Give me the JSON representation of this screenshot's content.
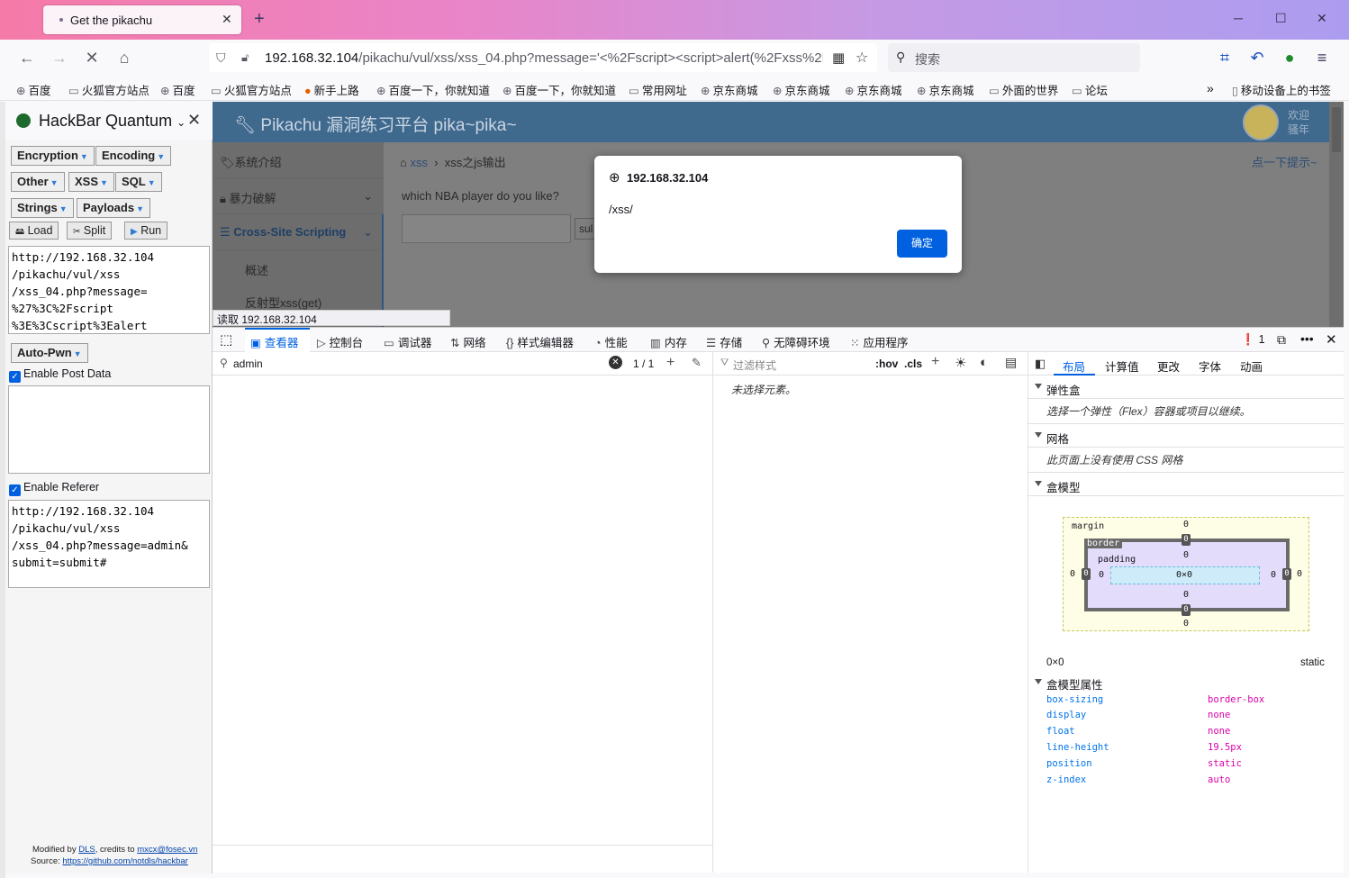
{
  "browser": {
    "tab_title": "Get the pikachu",
    "url_host": "192.168.32.104",
    "url_path": "/pikachu/vul/xss/xss_04.php?message='<%2Fscript><script>alert(%2Fxss%2F)",
    "search_placeholder": "搜索"
  },
  "bookmarks": [
    {
      "label": "百度"
    },
    {
      "label": "火狐官方站点"
    },
    {
      "label": "百度"
    },
    {
      "label": "火狐官方站点"
    },
    {
      "label": "新手上路"
    },
    {
      "label": "百度一下，你就知道"
    },
    {
      "label": "百度一下，你就知道"
    },
    {
      "label": "常用网址"
    },
    {
      "label": "京东商城"
    },
    {
      "label": "京东商城"
    },
    {
      "label": "京东商城"
    },
    {
      "label": "京东商城"
    },
    {
      "label": "外面的世界"
    },
    {
      "label": "论坛"
    },
    {
      "label": "移动设备上的书签"
    }
  ],
  "hackbar": {
    "title": "HackBar Quantum",
    "menus": [
      "Encryption",
      "Encoding",
      "Other",
      "XSS",
      "SQL",
      "Strings",
      "Payloads"
    ],
    "load": "Load",
    "split": "Split",
    "run": "Run",
    "url_text": "http://192.168.32.104\n/pikachu/vul/xss\n/xss_04.php?message=\n%27%3C%2Fscript\n%3E%3Cscript%3Ealert",
    "auto_pwn": "Auto-Pwn",
    "enable_post": "Enable Post Data",
    "enable_referer": "Enable Referer",
    "referer_text": "http://192.168.32.104\n/pikachu/vul/xss\n/xss_04.php?message=admin&\nsubmit=submit#",
    "footer_modified": "Modified by",
    "footer_dls": "DLS",
    "footer_credits": ", credits to",
    "footer_mail": "mxcx@fosec.vn",
    "footer_source": "Source:",
    "footer_link": "https://github.com/notdls/hackbar"
  },
  "page": {
    "site_title": "Pikachu 漏洞练习平台 pika~pika~",
    "welcome": "欢迎",
    "welcome2": "骚年",
    "nav": [
      "系统介绍",
      "暴力破解",
      "Cross-Site Scripting",
      "概述",
      "反射型xss(get)"
    ],
    "breadcrumb_1": "xss",
    "breadcrumb_2": "xss之js输出",
    "hint": "点一下提示~",
    "question": "which NBA player do you like?",
    "submit": "sul"
  },
  "dialog": {
    "host": "192.168.32.104",
    "message": "/xss/",
    "ok": "确定"
  },
  "status": "读取 192.168.32.104",
  "devtools": {
    "tabs": [
      "查看器",
      "控制台",
      "调试器",
      "网络",
      "样式编辑器",
      "性能",
      "内存",
      "存储",
      "无障碍环境",
      "应用程序"
    ],
    "error_count": "1",
    "search_value": "admin",
    "search_count": "1 / 1",
    "filter_placeholder": "过滤样式",
    "hov": ":hov",
    "cls": ".cls",
    "no_element": "未选择元素。",
    "layout_tabs": [
      "布局",
      "计算值",
      "更改",
      "字体",
      "动画"
    ],
    "flex_title": "弹性盒",
    "flex_note": "选择一个弹性（Flex）容器或项目以继续。",
    "grid_title": "网格",
    "grid_note": "此页面上没有使用 CSS 网格",
    "box_title": "盒模型",
    "box_margin": "margin",
    "box_border": "border",
    "box_padding": "padding",
    "box_zero": "0",
    "box_content": "0×0",
    "size": "0×0",
    "position": "static",
    "props_title": "盒模型属性",
    "props": [
      {
        "name": "box-sizing",
        "value": "border-box"
      },
      {
        "name": "display",
        "value": "none"
      },
      {
        "name": "float",
        "value": "none"
      },
      {
        "name": "line-height",
        "value": "19.5px"
      },
      {
        "name": "position",
        "value": "static"
      },
      {
        "name": "z-index",
        "value": "auto"
      }
    ]
  },
  "colors": {
    "accent": "#0061e0",
    "page_header": "#40698e",
    "prop_name": "#0074e8",
    "prop_value": "#dd00a9"
  }
}
